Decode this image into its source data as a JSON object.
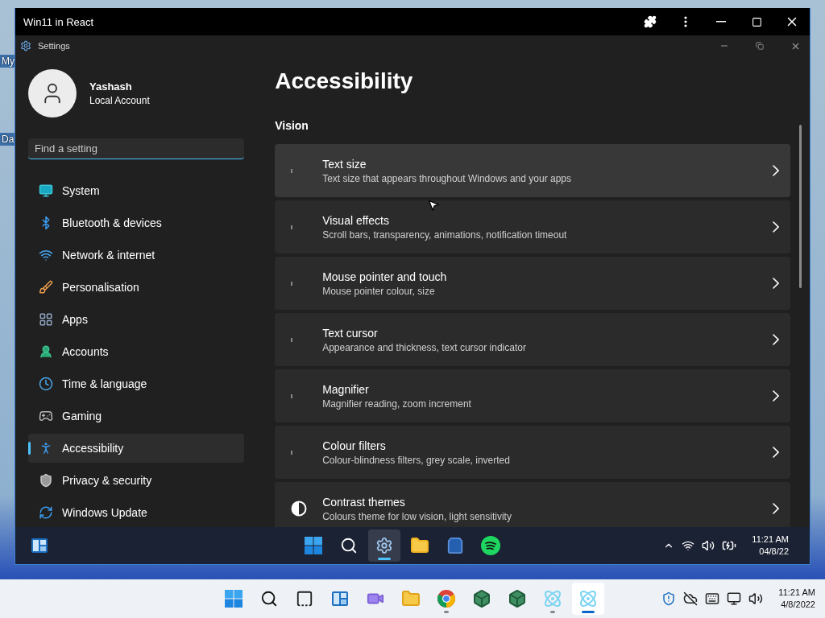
{
  "desktop": {
    "labels": [
      "My",
      "Da"
    ]
  },
  "browser": {
    "title": "Win11 in React"
  },
  "settings": {
    "title": "Settings",
    "profile": {
      "name": "Yashash",
      "account": "Local Account"
    },
    "search": {
      "placeholder": "Find a setting"
    },
    "nav": [
      {
        "label": "System",
        "selected": false
      },
      {
        "label": "Bluetooth & devices",
        "selected": false
      },
      {
        "label": "Network & internet",
        "selected": false
      },
      {
        "label": "Personalisation",
        "selected": false
      },
      {
        "label": "Apps",
        "selected": false
      },
      {
        "label": "Accounts",
        "selected": false
      },
      {
        "label": "Time & language",
        "selected": false
      },
      {
        "label": "Gaming",
        "selected": false
      },
      {
        "label": "Accessibility",
        "selected": true
      },
      {
        "label": "Privacy & security",
        "selected": false
      },
      {
        "label": "Windows Update",
        "selected": false
      }
    ],
    "page_title": "Accessibility",
    "section": "Vision",
    "cards": [
      {
        "title": "Text size",
        "description": "Text size that appears throughout Windows and your apps",
        "hovered": true
      },
      {
        "title": "Visual effects",
        "description": "Scroll bars, transparency, animations, notification timeout",
        "hovered": false
      },
      {
        "title": "Mouse pointer and touch",
        "description": "Mouse pointer colour, size",
        "hovered": false
      },
      {
        "title": "Text cursor",
        "description": "Appearance and thickness, text cursor indicator",
        "hovered": false
      },
      {
        "title": "Magnifier",
        "description": "Magnifier reading, zoom increment",
        "hovered": false
      },
      {
        "title": "Colour filters",
        "description": "Colour-blindness filters, grey scale, inverted",
        "hovered": false
      },
      {
        "title": "Contrast themes",
        "description": "Colours theme for low vision, light sensitivity",
        "hovered": false
      }
    ]
  },
  "inner_taskbar": {
    "apps": [
      {
        "selected": false
      },
      {
        "selected": false
      },
      {
        "selected": true
      },
      {
        "selected": false
      },
      {
        "selected": false
      },
      {
        "selected": false
      }
    ],
    "time": "11:21 AM",
    "date": "04/8/22"
  },
  "taskbar": {
    "apps": [
      {
        "running": false,
        "selected": false
      },
      {
        "running": false,
        "selected": false
      },
      {
        "running": false,
        "selected": false
      },
      {
        "running": false,
        "selected": false
      },
      {
        "running": false,
        "selected": false
      },
      {
        "running": false,
        "selected": false
      },
      {
        "running": true,
        "selected": false
      },
      {
        "running": false,
        "selected": false
      },
      {
        "running": false,
        "selected": false
      },
      {
        "running": true,
        "selected": false
      },
      {
        "running": true,
        "selected": true
      }
    ],
    "time": "11:21 AM",
    "date": "4/8/2022"
  }
}
